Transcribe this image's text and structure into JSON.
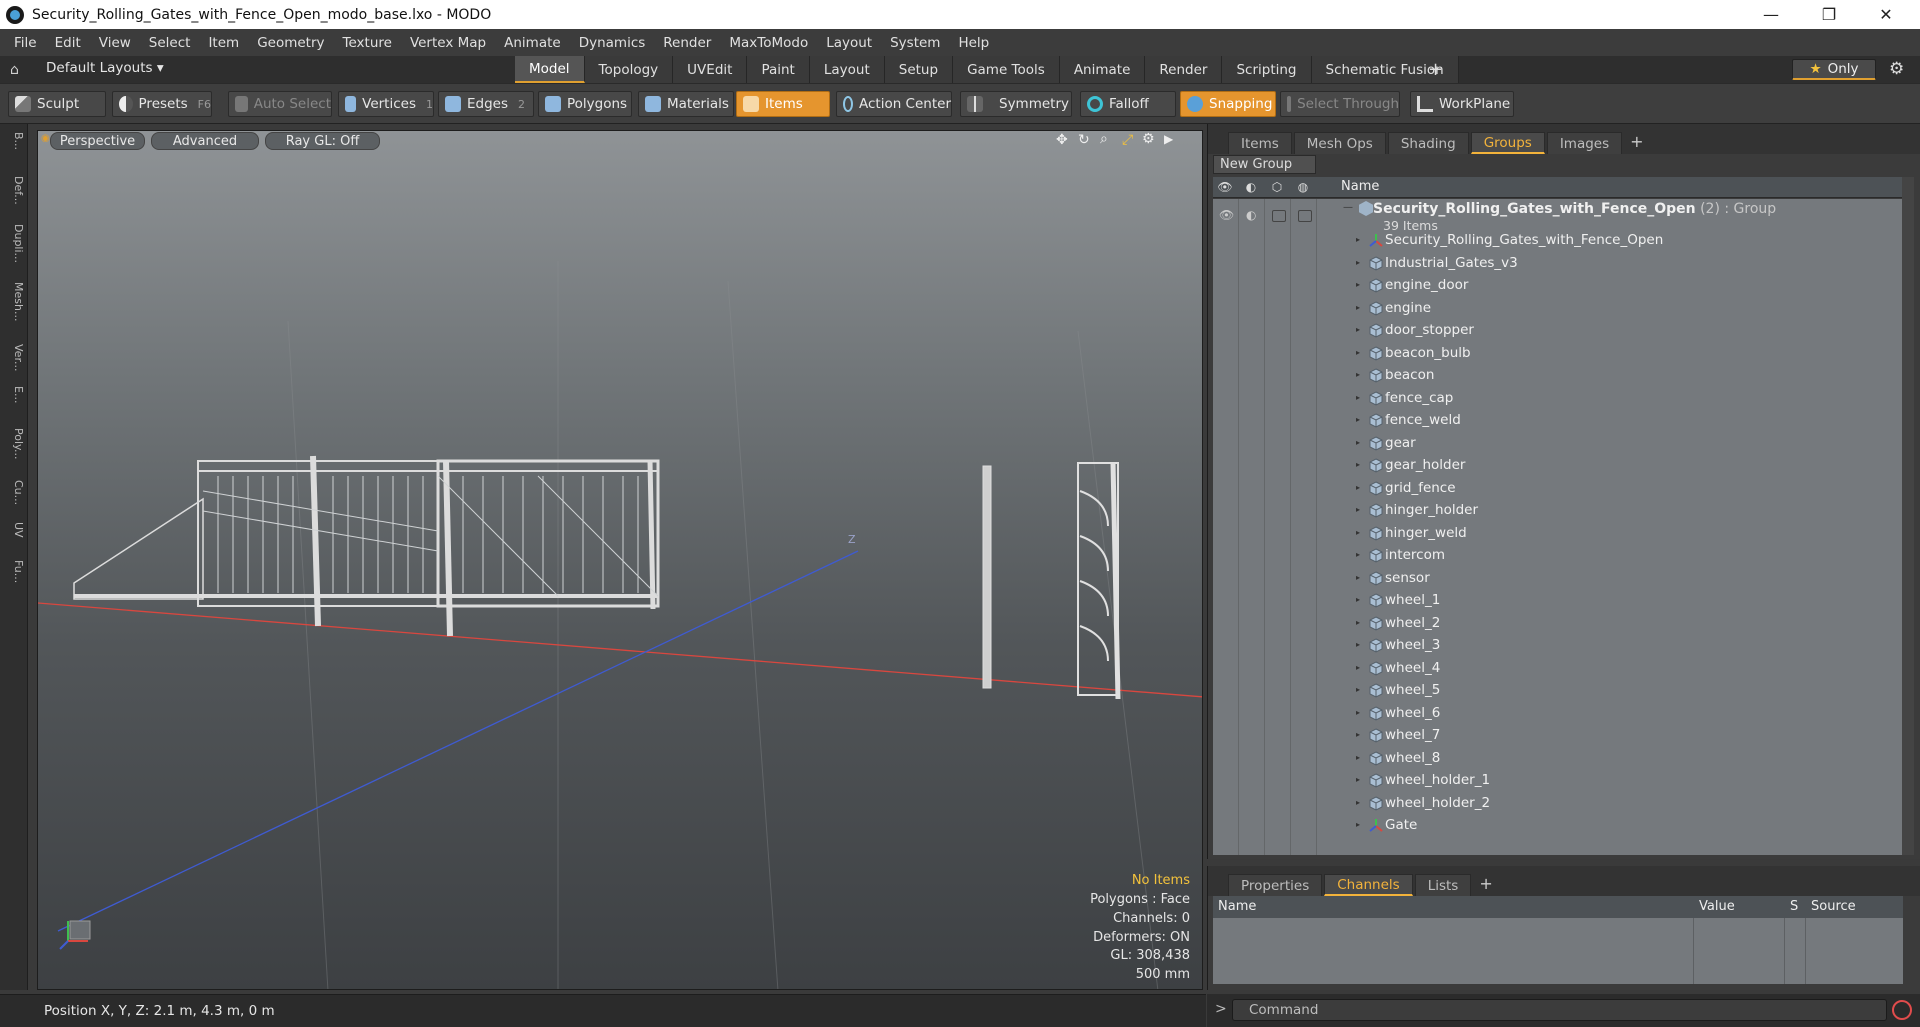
{
  "window": {
    "title": "Security_Rolling_Gates_with_Fence_Open_modo_base.lxo - MODO",
    "minimize": "—",
    "restore": "❐",
    "close": "✕"
  },
  "menu": [
    "File",
    "Edit",
    "View",
    "Select",
    "Item",
    "Geometry",
    "Texture",
    "Vertex Map",
    "Animate",
    "Dynamics",
    "Render",
    "MaxToModo",
    "Layout",
    "System",
    "Help"
  ],
  "layout_bar": {
    "layouts_dropdown": "Default Layouts ▾",
    "tabs": [
      "Model",
      "Topology",
      "UVEdit",
      "Paint",
      "Layout",
      "Setup",
      "Game Tools",
      "Animate",
      "Render",
      "Scripting",
      "Schematic Fusion"
    ],
    "active_tab": "Model",
    "plus": "+",
    "only_label": "Only",
    "star": "★"
  },
  "toolbar": {
    "sculpt": "Sculpt",
    "presets": "Presets",
    "presets_shortcut": "F6",
    "auto_select": "Auto Select",
    "vertices": "Vertices",
    "vertices_count": "1",
    "edges": "Edges",
    "edges_count": "2",
    "polygons": "Polygons",
    "materials": "Materials",
    "items": "Items",
    "action_center": "Action Center",
    "symmetry": "Symmetry",
    "falloff": "Falloff",
    "snapping": "Snapping",
    "select_through": "Select Through",
    "workplane": "WorkPlane"
  },
  "left_tabs": [
    "B...",
    "Def...",
    "Dupli...",
    "Mesh...",
    "Ver...",
    "E...",
    "Poly...",
    "Cu...",
    "UV",
    "Fu..."
  ],
  "viewport": {
    "perspective": "Perspective",
    "advanced": "Advanced",
    "raygl": "Ray GL: Off",
    "info": {
      "no_items": "No Items",
      "polygons": "Polygons : Face",
      "channels": "Channels: 0",
      "deformers": "Deformers: ON",
      "gl": "GL: 308,438",
      "scale": "500 mm"
    }
  },
  "items_panel": {
    "tabs": [
      "Items",
      "Mesh Ops",
      "Shading",
      "Groups",
      "Images"
    ],
    "active_tab": "Groups",
    "plus": "+",
    "new_group": "New Group",
    "name_header": "Name",
    "group": {
      "name": "Security_Rolling_Gates_with_Fence_Open",
      "suffix": " (2) : Group",
      "count": "39 Items"
    },
    "children": [
      {
        "label": "Security_Rolling_Gates_with_Fence_Open",
        "type": "locator"
      },
      {
        "label": "Industrial_Gates_v3",
        "type": "mesh"
      },
      {
        "label": "engine_door",
        "type": "mesh"
      },
      {
        "label": "engine",
        "type": "mesh"
      },
      {
        "label": "door_stopper",
        "type": "mesh"
      },
      {
        "label": "beacon_bulb",
        "type": "mesh"
      },
      {
        "label": "beacon",
        "type": "mesh"
      },
      {
        "label": "fence_cap",
        "type": "mesh"
      },
      {
        "label": "fence_weld",
        "type": "mesh"
      },
      {
        "label": "gear",
        "type": "mesh"
      },
      {
        "label": "gear_holder",
        "type": "mesh"
      },
      {
        "label": "grid_fence",
        "type": "mesh"
      },
      {
        "label": "hinger_holder",
        "type": "mesh"
      },
      {
        "label": "hinger_weld",
        "type": "mesh"
      },
      {
        "label": "intercom",
        "type": "mesh"
      },
      {
        "label": "sensor",
        "type": "mesh"
      },
      {
        "label": "wheel_1",
        "type": "mesh"
      },
      {
        "label": "wheel_2",
        "type": "mesh"
      },
      {
        "label": "wheel_3",
        "type": "mesh"
      },
      {
        "label": "wheel_4",
        "type": "mesh"
      },
      {
        "label": "wheel_5",
        "type": "mesh"
      },
      {
        "label": "wheel_6",
        "type": "mesh"
      },
      {
        "label": "wheel_7",
        "type": "mesh"
      },
      {
        "label": "wheel_8",
        "type": "mesh"
      },
      {
        "label": "wheel_holder_1",
        "type": "mesh"
      },
      {
        "label": "wheel_holder_2",
        "type": "mesh"
      },
      {
        "label": "Gate",
        "type": "locator"
      }
    ]
  },
  "channels_panel": {
    "tabs": [
      "Properties",
      "Channels",
      "Lists"
    ],
    "active_tab": "Channels",
    "plus": "+",
    "columns": [
      "Name",
      "Value",
      "S",
      "Source"
    ]
  },
  "status": {
    "position": "Position X, Y, Z:   2.1 m, 4.3 m, 0 m"
  },
  "command": {
    "prompt": ">",
    "placeholder": "Command"
  },
  "colors": {
    "accent": "#e5952e",
    "active_tab_text": "#f3b33b",
    "x_axis": "#d9473f",
    "z_axis": "#3f5bd1",
    "y_axis": "#3fbf4f"
  }
}
